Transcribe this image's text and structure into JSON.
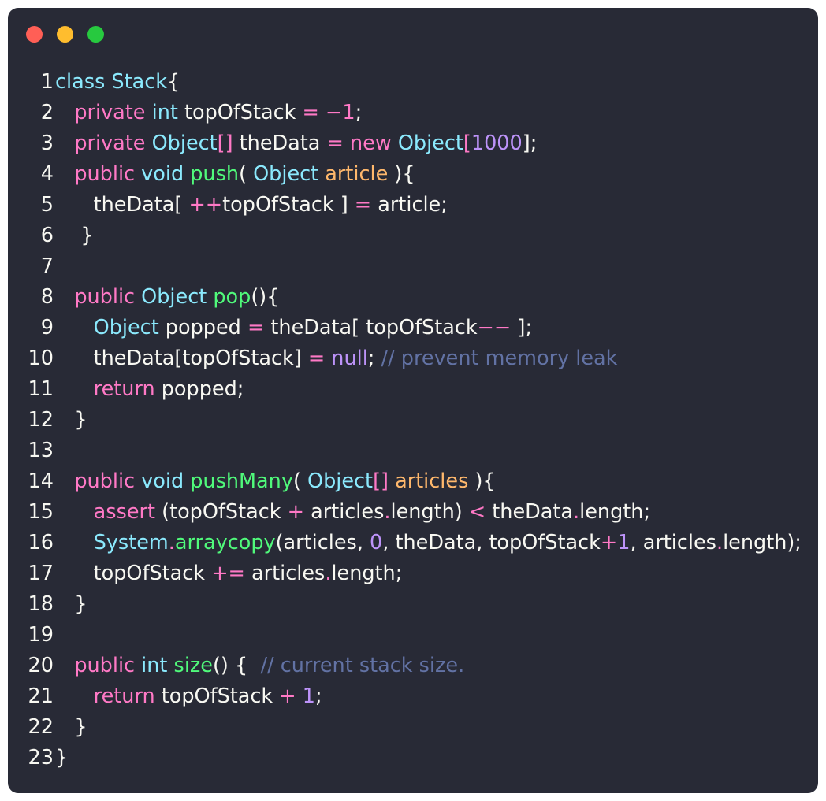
{
  "window": {
    "background": "#282a36",
    "controls": [
      {
        "name": "close-button",
        "color": "#ff5f56"
      },
      {
        "name": "minimize-button",
        "color": "#ffbd2e"
      },
      {
        "name": "zoom-button",
        "color": "#27c93f"
      }
    ]
  },
  "palette": {
    "text": "#f8f8f2",
    "keyword": "#ff79c6",
    "type": "#8be9fd",
    "function": "#50fa7b",
    "param": "#ffb86c",
    "number": "#bd93f9",
    "comment": "#6272a4"
  },
  "code": {
    "lines": [
      {
        "n": "1",
        "tokens": [
          [
            "class",
            "type"
          ],
          [
            " ",
            "text"
          ],
          [
            "Stack",
            "type"
          ],
          [
            "{",
            "text"
          ]
        ]
      },
      {
        "n": "2",
        "tokens": [
          [
            "   ",
            "text"
          ],
          [
            "private",
            "keyword"
          ],
          [
            " ",
            "text"
          ],
          [
            "int",
            "type"
          ],
          [
            " topOfStack ",
            "text"
          ],
          [
            "=",
            "keyword"
          ],
          [
            " ",
            "text"
          ],
          [
            "−1",
            "keyword"
          ],
          [
            ";",
            "text"
          ]
        ]
      },
      {
        "n": "3",
        "tokens": [
          [
            "   ",
            "text"
          ],
          [
            "private",
            "keyword"
          ],
          [
            " ",
            "text"
          ],
          [
            "Object",
            "type"
          ],
          [
            "[]",
            "keyword"
          ],
          [
            " theData ",
            "text"
          ],
          [
            "=",
            "keyword"
          ],
          [
            " ",
            "text"
          ],
          [
            "new",
            "keyword"
          ],
          [
            " ",
            "text"
          ],
          [
            "Object",
            "type"
          ],
          [
            "[",
            "keyword"
          ],
          [
            "1000",
            "number"
          ],
          [
            "];",
            "text"
          ]
        ]
      },
      {
        "n": "4",
        "tokens": [
          [
            "   ",
            "text"
          ],
          [
            "public",
            "keyword"
          ],
          [
            " ",
            "text"
          ],
          [
            "void",
            "type"
          ],
          [
            " ",
            "text"
          ],
          [
            "push",
            "function"
          ],
          [
            "( ",
            "text"
          ],
          [
            "Object",
            "type"
          ],
          [
            " ",
            "text"
          ],
          [
            "article",
            "param"
          ],
          [
            " ){",
            "text"
          ]
        ]
      },
      {
        "n": "5",
        "tokens": [
          [
            "      theData[ ",
            "text"
          ],
          [
            "++",
            "keyword"
          ],
          [
            "topOfStack ] ",
            "text"
          ],
          [
            "=",
            "keyword"
          ],
          [
            " article;",
            "text"
          ]
        ]
      },
      {
        "n": "6",
        "tokens": [
          [
            "    }",
            "text"
          ]
        ]
      },
      {
        "n": "7",
        "tokens": []
      },
      {
        "n": "8",
        "tokens": [
          [
            "   ",
            "text"
          ],
          [
            "public",
            "keyword"
          ],
          [
            " ",
            "text"
          ],
          [
            "Object",
            "type"
          ],
          [
            " ",
            "text"
          ],
          [
            "pop",
            "function"
          ],
          [
            "(){",
            "text"
          ]
        ]
      },
      {
        "n": "9",
        "tokens": [
          [
            "      ",
            "text"
          ],
          [
            "Object",
            "type"
          ],
          [
            " popped ",
            "text"
          ],
          [
            "=",
            "keyword"
          ],
          [
            " theData[ topOfStack",
            "text"
          ],
          [
            "−−",
            "keyword"
          ],
          [
            " ];",
            "text"
          ]
        ]
      },
      {
        "n": "10",
        "tokens": [
          [
            "      theData[topOfStack] ",
            "text"
          ],
          [
            "=",
            "keyword"
          ],
          [
            " ",
            "text"
          ],
          [
            "null",
            "number"
          ],
          [
            "; ",
            "text"
          ],
          [
            "// prevent memory leak",
            "comment"
          ]
        ]
      },
      {
        "n": "11",
        "tokens": [
          [
            "      ",
            "text"
          ],
          [
            "return",
            "keyword"
          ],
          [
            " popped;",
            "text"
          ]
        ]
      },
      {
        "n": "12",
        "tokens": [
          [
            "   }",
            "text"
          ]
        ]
      },
      {
        "n": "13",
        "tokens": []
      },
      {
        "n": "14",
        "tokens": [
          [
            "   ",
            "text"
          ],
          [
            "public",
            "keyword"
          ],
          [
            " ",
            "text"
          ],
          [
            "void",
            "type"
          ],
          [
            " ",
            "text"
          ],
          [
            "pushMany",
            "function"
          ],
          [
            "( ",
            "text"
          ],
          [
            "Object",
            "type"
          ],
          [
            "[]",
            "keyword"
          ],
          [
            " ",
            "text"
          ],
          [
            "articles",
            "param"
          ],
          [
            " ){",
            "text"
          ]
        ]
      },
      {
        "n": "15",
        "tokens": [
          [
            "      ",
            "text"
          ],
          [
            "assert",
            "keyword"
          ],
          [
            " (topOfStack ",
            "text"
          ],
          [
            "+",
            "keyword"
          ],
          [
            " articles",
            "text"
          ],
          [
            ".",
            "keyword"
          ],
          [
            "length) ",
            "text"
          ],
          [
            "<",
            "keyword"
          ],
          [
            " theData",
            "text"
          ],
          [
            ".",
            "keyword"
          ],
          [
            "length;",
            "text"
          ]
        ]
      },
      {
        "n": "16",
        "tokens": [
          [
            "      ",
            "text"
          ],
          [
            "System",
            "type"
          ],
          [
            ".",
            "keyword"
          ],
          [
            "arraycopy",
            "function"
          ],
          [
            "(articles, ",
            "text"
          ],
          [
            "0",
            "number"
          ],
          [
            ", theData, topOfStack",
            "text"
          ],
          [
            "+",
            "keyword"
          ],
          [
            "1",
            "number"
          ],
          [
            ", articles",
            "text"
          ],
          [
            ".",
            "keyword"
          ],
          [
            "length);",
            "text"
          ]
        ]
      },
      {
        "n": "17",
        "tokens": [
          [
            "      topOfStack ",
            "text"
          ],
          [
            "+=",
            "keyword"
          ],
          [
            " articles",
            "text"
          ],
          [
            ".",
            "keyword"
          ],
          [
            "length;",
            "text"
          ]
        ]
      },
      {
        "n": "18",
        "tokens": [
          [
            "   }",
            "text"
          ]
        ]
      },
      {
        "n": "19",
        "tokens": []
      },
      {
        "n": "20",
        "tokens": [
          [
            "   ",
            "text"
          ],
          [
            "public",
            "keyword"
          ],
          [
            " ",
            "text"
          ],
          [
            "int",
            "type"
          ],
          [
            " ",
            "text"
          ],
          [
            "size",
            "function"
          ],
          [
            "() {  ",
            "text"
          ],
          [
            "// current stack size.",
            "comment"
          ]
        ]
      },
      {
        "n": "21",
        "tokens": [
          [
            "      ",
            "text"
          ],
          [
            "return",
            "keyword"
          ],
          [
            " topOfStack ",
            "text"
          ],
          [
            "+",
            "keyword"
          ],
          [
            " ",
            "text"
          ],
          [
            "1",
            "number"
          ],
          [
            ";",
            "text"
          ]
        ]
      },
      {
        "n": "22",
        "tokens": [
          [
            "   }",
            "text"
          ]
        ]
      },
      {
        "n": "23",
        "tokens": [
          [
            "}",
            "text"
          ]
        ]
      }
    ]
  }
}
